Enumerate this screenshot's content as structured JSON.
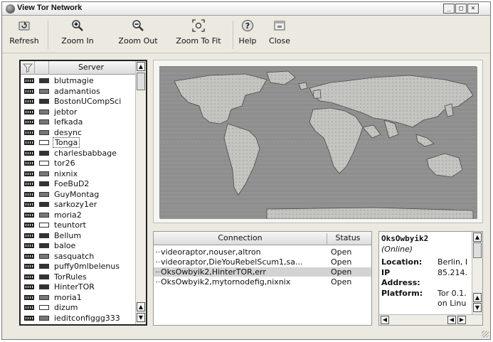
{
  "window": {
    "title": "View Tor Network"
  },
  "toolbar": {
    "buttons": [
      {
        "label": "Refresh",
        "icon": "refresh-icon"
      },
      {
        "label": "Zoom In",
        "icon": "zoom-in-icon"
      },
      {
        "label": "Zoom Out",
        "icon": "zoom-out-icon"
      },
      {
        "label": "Zoom To Fit",
        "icon": "zoom-to-fit-icon"
      },
      {
        "label": "Help",
        "icon": "help-icon"
      },
      {
        "label": "Close",
        "icon": "close-icon"
      }
    ]
  },
  "server_list": {
    "column_header": "Server",
    "selected": "Tonga",
    "servers": [
      "blutmagie",
      "adamantios",
      "BostonUCompSci",
      "jebtor",
      "lefkada",
      "desync",
      "Tonga",
      "charlesbabbage",
      "tor26",
      "nixnix",
      "FoeBuD2",
      "GuyMontag",
      "sarkozy1er",
      "moria2",
      "teuntort",
      "Bellum",
      "baloe",
      "sasquatch",
      "puffy0mlbelenus",
      "TorRules",
      "HinterTOR",
      "moria1",
      "dizum",
      "ieditconfiggg333"
    ]
  },
  "connections": {
    "headers": {
      "connection": "Connection",
      "status": "Status"
    },
    "rows": [
      {
        "connection": "videoraptor,nouser,altron",
        "status": "Open"
      },
      {
        "connection": "videoraptor,DieYouRebelScum1,sa...",
        "status": "Open"
      },
      {
        "connection": "OksOwbyik2,HinterTOR,err",
        "status": "Open"
      },
      {
        "connection": "OksOwbyik2,mytornodefig,nixnix",
        "status": "Open"
      }
    ],
    "selected_row": 2
  },
  "router_info": {
    "name": "OksOwbyik2",
    "state": "(Online)",
    "fields": [
      {
        "label": "Location:",
        "value": "Berlin, I"
      },
      {
        "label": "IP",
        "value": "85.214."
      },
      {
        "label": "Address:",
        "value": ""
      },
      {
        "label": "Platform:",
        "value": "Tor 0.1."
      },
      {
        "label": "",
        "value": "on Linu"
      }
    ]
  },
  "colors": {
    "window_bg": "#ece9e1",
    "selection": "#d3d3d3"
  }
}
